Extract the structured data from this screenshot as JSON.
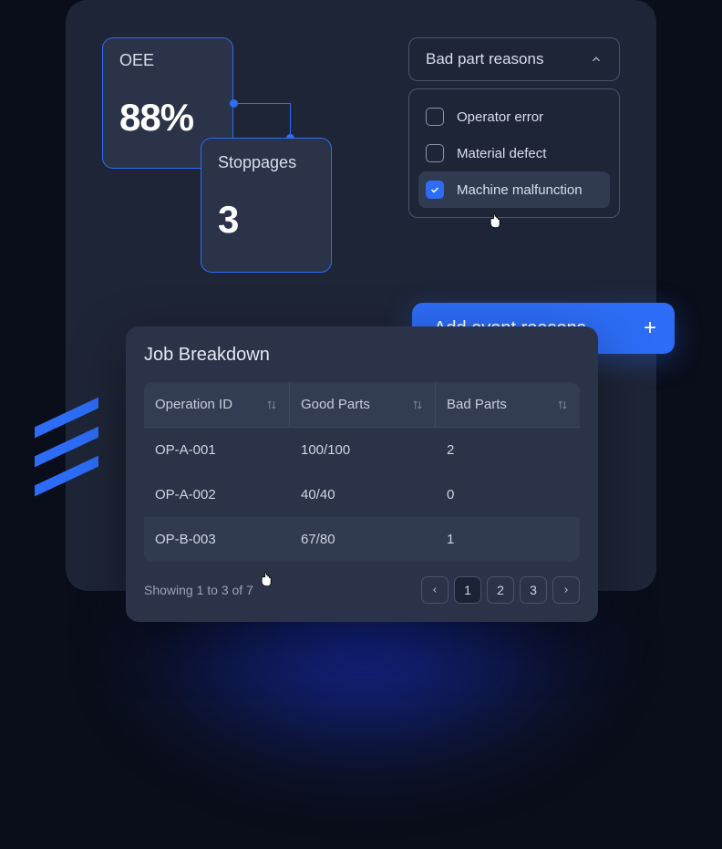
{
  "oee": {
    "label": "OEE",
    "value": "88%"
  },
  "stoppages": {
    "label": "Stoppages",
    "value": "3"
  },
  "dropdown": {
    "label": "Bad part reasons"
  },
  "options": [
    {
      "label": "Operator error",
      "checked": false
    },
    {
      "label": "Material defect",
      "checked": false
    },
    {
      "label": "Machine malfunction",
      "checked": true
    }
  ],
  "addButton": {
    "label": "Add event reasons"
  },
  "table": {
    "title": "Job Breakdown",
    "columns": [
      "Operation ID",
      "Good Parts",
      "Bad Parts"
    ],
    "rows": [
      {
        "op": "OP-A-001",
        "good": "100/100",
        "bad": "2"
      },
      {
        "op": "OP-A-002",
        "good": "40/40",
        "bad": "0"
      },
      {
        "op": "OP-B-003",
        "good": "67/80",
        "bad": "1"
      }
    ]
  },
  "pagination": {
    "text": "Showing 1 to 3 of 7",
    "pages": [
      "1",
      "2",
      "3"
    ],
    "activePage": "1"
  }
}
